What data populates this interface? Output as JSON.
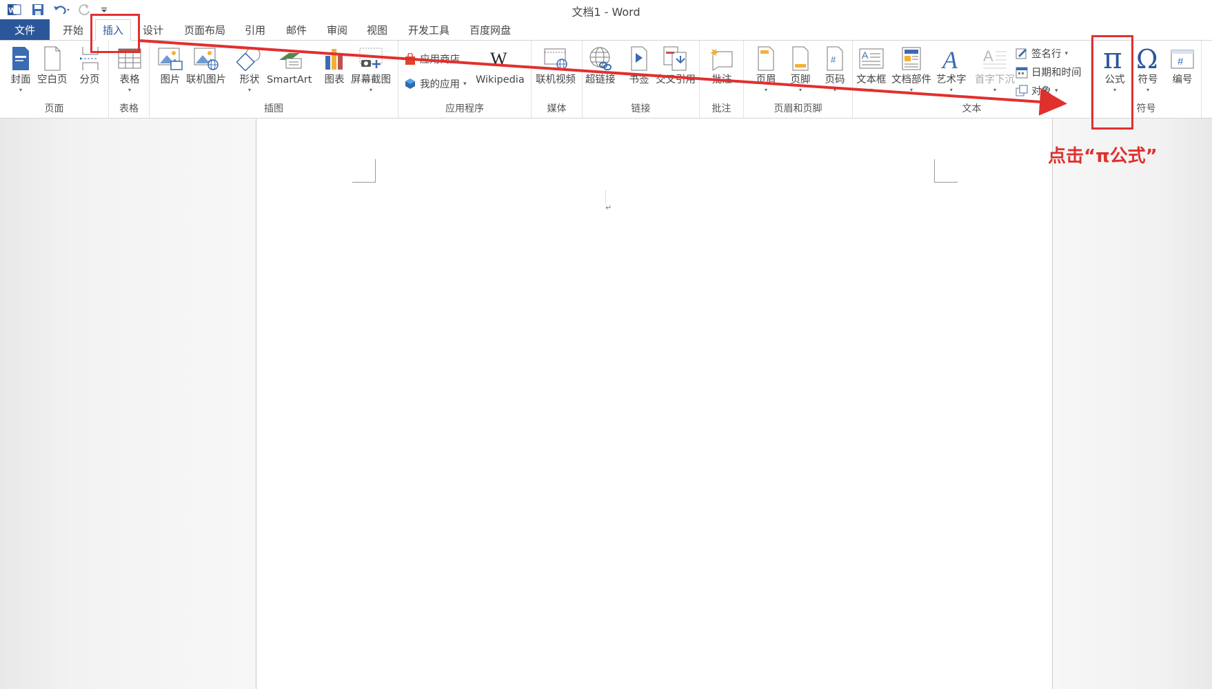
{
  "window": {
    "title": "文档1 - Word"
  },
  "tabs": {
    "file": "文件",
    "home": "开始",
    "insert": "插入",
    "design": "设计",
    "layout": "页面布局",
    "references": "引用",
    "mailings": "邮件",
    "review": "审阅",
    "view": "视图",
    "developer": "开发工具",
    "baidu": "百度网盘"
  },
  "ribbon": {
    "pages": {
      "label": "页面",
      "cover": "封面",
      "blank": "空白页",
      "break": "分页"
    },
    "tables": {
      "label": "表格",
      "table": "表格"
    },
    "illustrations": {
      "label": "插图",
      "picture": "图片",
      "online_picture": "联机图片",
      "shapes": "形状",
      "smartart": "SmartArt",
      "chart": "图表",
      "screenshot": "屏幕截图"
    },
    "apps": {
      "label": "应用程序",
      "store": "应用商店",
      "my_apps": "我的应用",
      "wikipedia": "Wikipedia"
    },
    "media": {
      "label": "媒体",
      "online_video": "联机视频"
    },
    "links": {
      "label": "链接",
      "hyperlink": "超链接",
      "bookmark": "书签",
      "cross_ref": "交叉引用"
    },
    "comments": {
      "label": "批注",
      "comment": "批注"
    },
    "header_footer": {
      "label": "页眉和页脚",
      "header": "页眉",
      "footer": "页脚",
      "page_number": "页码"
    },
    "text": {
      "label": "文本",
      "textbox": "文本框",
      "quick_parts": "文档部件",
      "wordart": "艺术字",
      "dropcap": "首字下沉",
      "signature": "签名行",
      "datetime": "日期和时间",
      "object": "对象"
    },
    "symbols": {
      "label": "符号",
      "equation": "公式",
      "symbol": "符号",
      "numbering": "编号"
    }
  },
  "annotation": {
    "text": "点击“π公式”",
    "color": "#e0302e"
  },
  "colors": {
    "accent": "#2b579a"
  }
}
